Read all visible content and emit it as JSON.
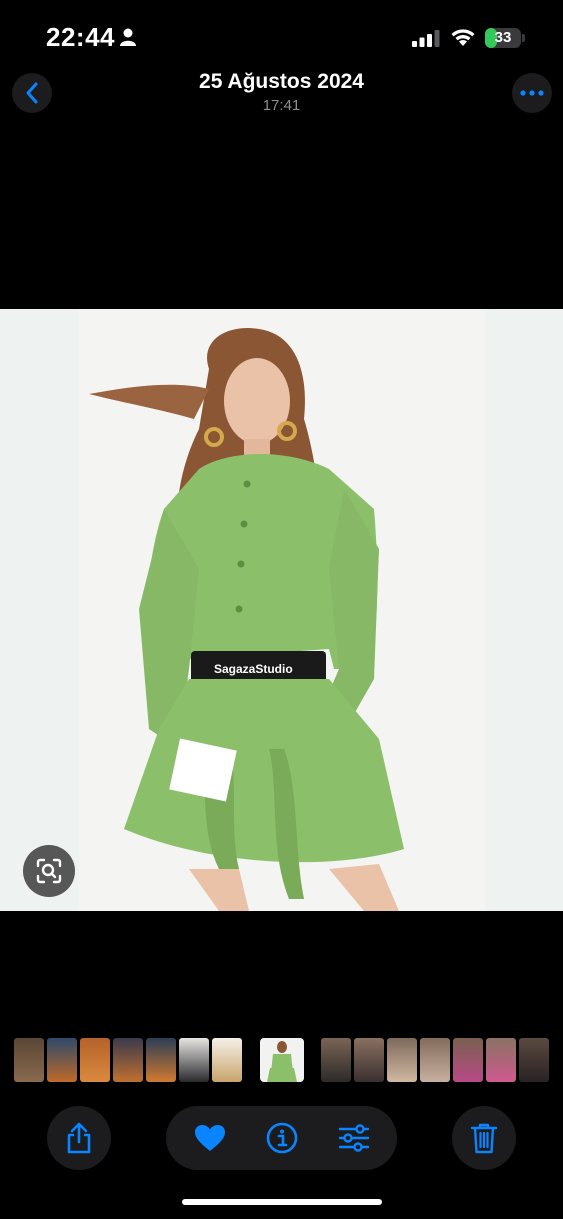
{
  "status_bar": {
    "time": "22:44",
    "battery": "33",
    "battery_level": 0.33,
    "icons": [
      "person-icon",
      "cellular-signal-icon",
      "wifi-icon",
      "battery-icon"
    ]
  },
  "nav": {
    "title": "25 Ağustos 2024",
    "subtitle": "17:41",
    "back_icon": "chevron-left-icon",
    "more_icon": "ellipsis-icon"
  },
  "photo": {
    "brand_band": "SagazaStudio"
  },
  "toolbar": {
    "icons": [
      "share-icon",
      "heart-icon",
      "info-icon",
      "sliders-icon",
      "trash-icon"
    ]
  },
  "colors": {
    "accent": "#0a84ff",
    "dress_green": "#8cbf6a",
    "background": "#000000"
  }
}
